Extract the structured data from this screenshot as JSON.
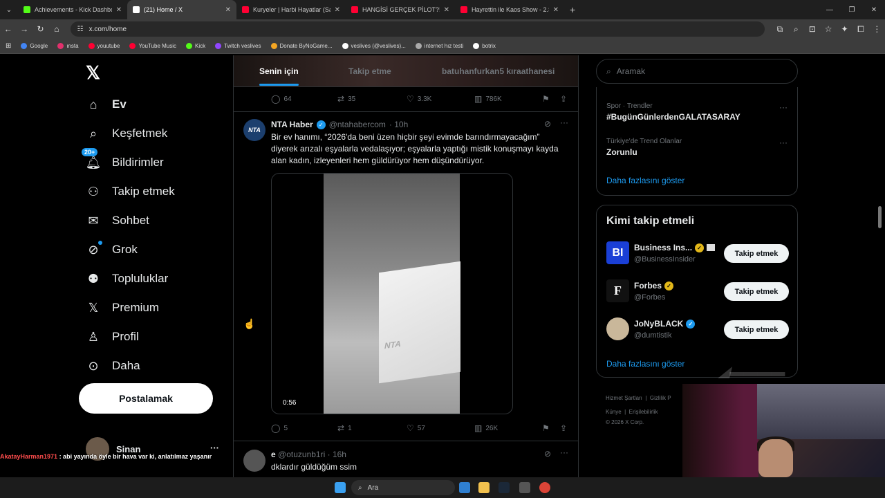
{
  "browser": {
    "tabs": [
      {
        "title": "Achievements - Kick Dashboard",
        "color": "#53fc18"
      },
      {
        "title": "(21) Home / X",
        "color": "#ffffff"
      },
      {
        "title": "Kuryeler | Harbi Hayatlar (Sansü",
        "color": "#ff0033"
      },
      {
        "title": "HANGİSİ GERÇEK PİLOT?! ft. @/",
        "color": "#ff0033"
      },
      {
        "title": "Hayrettin ile Kaos Show - 2.Sez",
        "color": "#ff0033"
      }
    ],
    "url": "x.com/home",
    "bookmarks": [
      {
        "label": "Google",
        "color": "#4285f4"
      },
      {
        "label": "ınsta",
        "color": "#e1306c"
      },
      {
        "label": "youutube",
        "color": "#ff0033"
      },
      {
        "label": "YouTube Music",
        "color": "#ff0033"
      },
      {
        "label": "Kick",
        "color": "#53fc18"
      },
      {
        "label": "Twitch veslives",
        "color": "#9146ff"
      },
      {
        "label": "Donate ByNoGame...",
        "color": "#f5a623"
      },
      {
        "label": "veslives (@veslives)...",
        "color": "#ffffff"
      },
      {
        "label": "internet hız testi",
        "color": "#aaaaaa"
      },
      {
        "label": "botrix",
        "color": "#ffffff"
      }
    ]
  },
  "sidebar": {
    "items": [
      {
        "label": "Ev",
        "icon": "home-icon"
      },
      {
        "label": "Keşfetmek",
        "icon": "search-icon"
      },
      {
        "label": "Bildirimler",
        "icon": "bell-icon",
        "badge": "20+"
      },
      {
        "label": "Takip etmek",
        "icon": "follow-icon"
      },
      {
        "label": "Sohbet",
        "icon": "mail-icon"
      },
      {
        "label": "Grok",
        "icon": "grok-icon"
      },
      {
        "label": "Topluluklar",
        "icon": "communities-icon"
      },
      {
        "label": "Premium",
        "icon": "x-icon"
      },
      {
        "label": "Profil",
        "icon": "profile-icon"
      },
      {
        "label": "Daha",
        "icon": "more-icon"
      }
    ],
    "post_label": "Postalamak",
    "profile_name": "Sinan",
    "profile_more": "···"
  },
  "chat_overlay": {
    "user": "AkatayHarman1971",
    "message": " : abi yayında öyle bir hava var ki, anlatılmaz yaşanır"
  },
  "feed": {
    "tabs": [
      "Senin için",
      "Takip etme",
      "batuhanfurkan5 kıraathanesi"
    ],
    "prev_actions": {
      "reply": "64",
      "repost": "35",
      "like": "3.3K",
      "views": "786K"
    },
    "tweet": {
      "avatar_text": "NTA",
      "name": "NTA Haber",
      "handle": "@ntahabercom",
      "time": "· 10h",
      "text": "Bir ev hanımı, “2026'da beni üzen hiçbir şeyi evimde barındırmayacağım” diyerek arızalı eşyalarla vedalaşıyor; eşyalarla yaptığı mistik konuşmayı kayda alan kadın, izleyenleri hem güldürüyor hem düşündürüyor.",
      "video_label": "NTA",
      "duration": "0:56",
      "actions": {
        "reply": "5",
        "repost": "1",
        "like": "57",
        "views": "26K"
      }
    },
    "tweet2": {
      "name": "e",
      "handle": "@otuzunb1ri",
      "time": "· 16h",
      "text": "dklardır güldüğüm ssim"
    }
  },
  "right": {
    "search_placeholder": "Aramak",
    "trends": [
      {
        "context": "Spor · Trendler",
        "name": "#BugünGünlerdenGALATASARAY"
      },
      {
        "context": "Türkiye'de Trend Olanlar",
        "name": "Zorunlu"
      }
    ],
    "show_more": "Daha fazlasını göster",
    "who_to_follow": {
      "title": "Kimi takip etmeli",
      "accounts": [
        {
          "name": "Business Ins...",
          "handle": "@BusinessInsider",
          "avatar": "BI",
          "verify": "gold"
        },
        {
          "name": "Forbes",
          "handle": "@Forbes",
          "avatar": "F",
          "verify": "gold"
        },
        {
          "name": "JoNyBLACK",
          "handle": "@dumtistik",
          "avatar": "",
          "verify": "blue"
        }
      ],
      "follow_label": "Takip etmek",
      "show_more": "Daha fazlasını göster"
    },
    "footer": {
      "line1a": "Hizmet Şartları",
      "line1b": "Gizlilik P",
      "line2a": "Künye",
      "line2b": "Erişilebilirlik",
      "line3": "© 2026 X Corp."
    }
  },
  "taskbar": {
    "search": "Ara"
  }
}
